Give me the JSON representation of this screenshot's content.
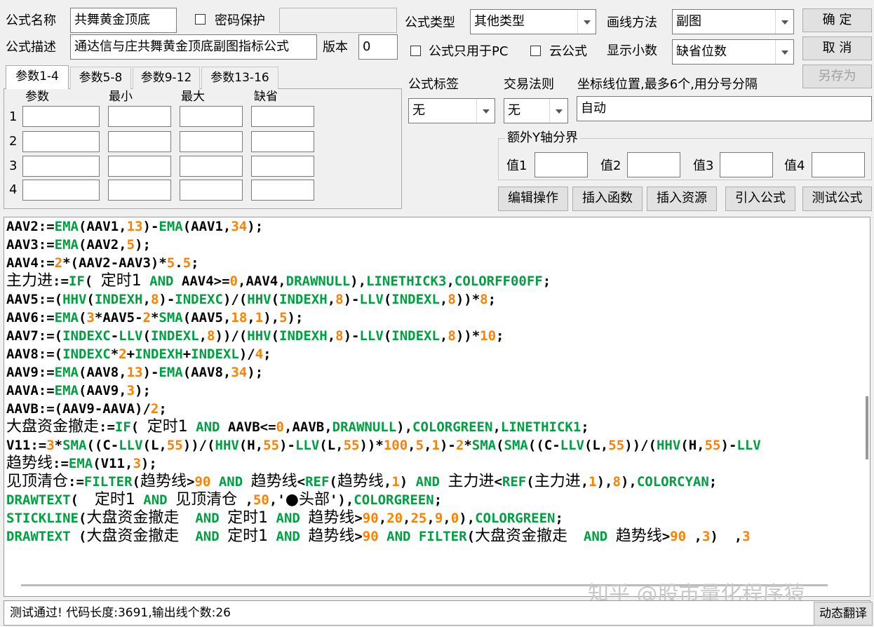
{
  "header": {
    "name_label": "公式名称",
    "name_value": "共舞黄金顶底",
    "password_label": "密码保护",
    "desc_label": "公式描述",
    "desc_value": "通达信与庄共舞黄金顶底副图指标公式",
    "version_label": "版本",
    "version_value": "0",
    "type_label": "公式类型",
    "type_value": "其他类型",
    "draw_label": "画线方法",
    "draw_value": "副图",
    "pc_only_label": "公式只用于PC",
    "cloud_label": "云公式",
    "decimals_label": "显示小数",
    "decimals_value": "缺省位数"
  },
  "buttons": {
    "ok": "确 定",
    "cancel": "取 消",
    "save_as": "另存为",
    "edit_op": "编辑操作",
    "insert_func": "插入函数",
    "insert_res": "插入资源",
    "import_formula": "引入公式",
    "test_formula": "测试公式",
    "dynamic_translate": "动态翻译"
  },
  "tabs": [
    "参数1-4",
    "参数5-8",
    "参数9-12",
    "参数13-16"
  ],
  "params": {
    "headers": [
      "参数",
      "最小",
      "最大",
      "缺省"
    ],
    "rows": [
      "1",
      "2",
      "3",
      "4"
    ]
  },
  "tags": {
    "tag_label": "公式标签",
    "tag_value": "无",
    "rule_label": "交易法则",
    "rule_value": "无",
    "axis_label": "坐标线位置,最多6个,用分号分隔",
    "axis_value": "自动"
  },
  "yaxis": {
    "title": "额外Y轴分界",
    "v1": "值1",
    "v2": "值2",
    "v3": "值3",
    "v4": "值4"
  },
  "code_lines": [
    [
      [
        "AAV2:=",
        ""
      ],
      [
        "EMA",
        "g"
      ],
      [
        "(AAV1,",
        ""
      ],
      [
        "13",
        "o"
      ],
      [
        ")-",
        ""
      ],
      [
        "EMA",
        "g"
      ],
      [
        "(AAV1,",
        ""
      ],
      [
        "34",
        "o"
      ],
      [
        ");",
        ""
      ]
    ],
    [
      [
        "AAV3:=",
        ""
      ],
      [
        "EMA",
        "g"
      ],
      [
        "(AAV2,",
        ""
      ],
      [
        "5",
        "o"
      ],
      [
        ");",
        ""
      ]
    ],
    [
      [
        "AAV4:=",
        ""
      ],
      [
        "2",
        "o"
      ],
      [
        "*(AAV2-AAV3)*",
        ""
      ],
      [
        "5",
        "o"
      ],
      [
        ".",
        ""
      ],
      [
        "5",
        "o"
      ],
      [
        ";",
        ""
      ]
    ],
    [
      [
        "主力进",
        "c"
      ],
      [
        ":=",
        ""
      ],
      [
        "IF",
        "g"
      ],
      [
        "( ",
        ""
      ],
      [
        "定时1",
        "c"
      ],
      [
        " ",
        ""
      ],
      [
        "AND",
        "g"
      ],
      [
        " AAV4>=",
        ""
      ],
      [
        "0",
        "o"
      ],
      [
        ",AAV4,",
        ""
      ],
      [
        "DRAWNULL",
        "g"
      ],
      [
        "),",
        ""
      ],
      [
        "LINETHICK3",
        "g"
      ],
      [
        ",",
        ""
      ],
      [
        "COLORFF00FF",
        "g"
      ],
      [
        ";",
        ""
      ]
    ],
    [
      [
        "AAV5:=(",
        ""
      ],
      [
        "HHV",
        "g"
      ],
      [
        "(",
        ""
      ],
      [
        "INDEXH",
        "g"
      ],
      [
        ",",
        ""
      ],
      [
        "8",
        "o"
      ],
      [
        ")-",
        ""
      ],
      [
        "INDEXC",
        "g"
      ],
      [
        ")/(",
        ""
      ],
      [
        "HHV",
        "g"
      ],
      [
        "(",
        ""
      ],
      [
        "INDEXH",
        "g"
      ],
      [
        ",",
        ""
      ],
      [
        "8",
        "o"
      ],
      [
        ")-",
        ""
      ],
      [
        "LLV",
        "g"
      ],
      [
        "(",
        ""
      ],
      [
        "INDEXL",
        "g"
      ],
      [
        ",",
        ""
      ],
      [
        "8",
        "o"
      ],
      [
        "))*",
        ""
      ],
      [
        "8",
        "o"
      ],
      [
        ";",
        ""
      ]
    ],
    [
      [
        "AAV6:=",
        ""
      ],
      [
        "EMA",
        "g"
      ],
      [
        "(",
        ""
      ],
      [
        "3",
        "o"
      ],
      [
        "*AAV5-",
        ""
      ],
      [
        "2",
        "o"
      ],
      [
        "*",
        ""
      ],
      [
        "SMA",
        "g"
      ],
      [
        "(AAV5,",
        ""
      ],
      [
        "18",
        "o"
      ],
      [
        ",",
        ""
      ],
      [
        "1",
        "o"
      ],
      [
        "),",
        ""
      ],
      [
        "5",
        "o"
      ],
      [
        ");",
        ""
      ]
    ],
    [
      [
        "AAV7:=(",
        ""
      ],
      [
        "INDEXC",
        "g"
      ],
      [
        "-",
        ""
      ],
      [
        "LLV",
        "g"
      ],
      [
        "(",
        ""
      ],
      [
        "INDEXL",
        "g"
      ],
      [
        ",",
        ""
      ],
      [
        "8",
        "o"
      ],
      [
        "))/(",
        ""
      ],
      [
        "HHV",
        "g"
      ],
      [
        "(",
        ""
      ],
      [
        "INDEXH",
        "g"
      ],
      [
        ",",
        ""
      ],
      [
        "8",
        "o"
      ],
      [
        ")-",
        ""
      ],
      [
        "LLV",
        "g"
      ],
      [
        "(",
        ""
      ],
      [
        "INDEXL",
        "g"
      ],
      [
        ",",
        ""
      ],
      [
        "8",
        "o"
      ],
      [
        "))*",
        ""
      ],
      [
        "10",
        "o"
      ],
      [
        ";",
        ""
      ]
    ],
    [
      [
        "AAV8:=(",
        ""
      ],
      [
        "INDEXC",
        "g"
      ],
      [
        "*",
        ""
      ],
      [
        "2",
        "o"
      ],
      [
        "+",
        ""
      ],
      [
        "INDEXH",
        "g"
      ],
      [
        "+",
        ""
      ],
      [
        "INDEXL",
        "g"
      ],
      [
        ")/",
        ""
      ],
      [
        "4",
        "o"
      ],
      [
        ";",
        ""
      ]
    ],
    [
      [
        "AAV9:=",
        ""
      ],
      [
        "EMA",
        "g"
      ],
      [
        "(AAV8,",
        ""
      ],
      [
        "13",
        "o"
      ],
      [
        ")-",
        ""
      ],
      [
        "EMA",
        "g"
      ],
      [
        "(AAV8,",
        ""
      ],
      [
        "34",
        "o"
      ],
      [
        ");",
        ""
      ]
    ],
    [
      [
        "AAVA:=",
        ""
      ],
      [
        "EMA",
        "g"
      ],
      [
        "(AAV9,",
        ""
      ],
      [
        "3",
        "o"
      ],
      [
        ");",
        ""
      ]
    ],
    [
      [
        "AAVB:=(AAV9-AAVA)/",
        ""
      ],
      [
        "2",
        "o"
      ],
      [
        ";",
        ""
      ]
    ],
    [
      [
        "大盘资金撤走",
        "c"
      ],
      [
        ":=",
        ""
      ],
      [
        "IF",
        "g"
      ],
      [
        "( ",
        ""
      ],
      [
        "定时1",
        "c"
      ],
      [
        " ",
        ""
      ],
      [
        "AND",
        "g"
      ],
      [
        " AAVB<=",
        ""
      ],
      [
        "0",
        "o"
      ],
      [
        ",AAVB,",
        ""
      ],
      [
        "DRAWNULL",
        "g"
      ],
      [
        "),",
        ""
      ],
      [
        "COLORGREEN",
        "g"
      ],
      [
        ",",
        ""
      ],
      [
        "LINETHICK1",
        "g"
      ],
      [
        ";",
        ""
      ]
    ],
    [
      [
        "V11:=",
        ""
      ],
      [
        "3",
        "o"
      ],
      [
        "*",
        ""
      ],
      [
        "SMA",
        "g"
      ],
      [
        "((C-",
        ""
      ],
      [
        "LLV",
        "g"
      ],
      [
        "(L,",
        ""
      ],
      [
        "55",
        "o"
      ],
      [
        "))/(",
        ""
      ],
      [
        "HHV",
        "g"
      ],
      [
        "(H,",
        ""
      ],
      [
        "55",
        "o"
      ],
      [
        ")-",
        ""
      ],
      [
        "LLV",
        "g"
      ],
      [
        "(L,",
        ""
      ],
      [
        "55",
        "o"
      ],
      [
        "))*",
        ""
      ],
      [
        "100",
        "o"
      ],
      [
        ",",
        ""
      ],
      [
        "5",
        "o"
      ],
      [
        ",",
        ""
      ],
      [
        "1",
        "o"
      ],
      [
        ")-",
        ""
      ],
      [
        "2",
        "o"
      ],
      [
        "*",
        ""
      ],
      [
        "SMA",
        "g"
      ],
      [
        "(",
        ""
      ],
      [
        "SMA",
        "g"
      ],
      [
        "((C-",
        ""
      ],
      [
        "LLV",
        "g"
      ],
      [
        "(L,",
        ""
      ],
      [
        "55",
        "o"
      ],
      [
        "))/(",
        ""
      ],
      [
        "HHV",
        "g"
      ],
      [
        "(H,",
        ""
      ],
      [
        "55",
        "o"
      ],
      [
        ")-",
        ""
      ],
      [
        "LLV",
        "g"
      ],
      [
        "",
        ""
      ]
    ],
    [
      [
        "趋势线",
        "c"
      ],
      [
        ":=",
        ""
      ],
      [
        "EMA",
        "g"
      ],
      [
        "(V11,",
        ""
      ],
      [
        "3",
        "o"
      ],
      [
        ");",
        ""
      ]
    ],
    [
      [
        "见顶清仓",
        "c"
      ],
      [
        ":=",
        ""
      ],
      [
        "FILTER",
        "g"
      ],
      [
        "(",
        ""
      ],
      [
        "趋势线",
        "c"
      ],
      [
        ">",
        ""
      ],
      [
        "90",
        "o"
      ],
      [
        " ",
        ""
      ],
      [
        "AND",
        "g"
      ],
      [
        " ",
        ""
      ],
      [
        "趋势线",
        "c"
      ],
      [
        "<",
        ""
      ],
      [
        "REF",
        "g"
      ],
      [
        "(",
        ""
      ],
      [
        "趋势线",
        "c"
      ],
      [
        ",",
        ""
      ],
      [
        "1",
        "o"
      ],
      [
        ") ",
        ""
      ],
      [
        "AND",
        "g"
      ],
      [
        " ",
        ""
      ],
      [
        "主力进",
        "c"
      ],
      [
        "<",
        ""
      ],
      [
        "REF",
        "g"
      ],
      [
        "(",
        ""
      ],
      [
        "主力进",
        "c"
      ],
      [
        ",",
        ""
      ],
      [
        "1",
        "o"
      ],
      [
        "),",
        ""
      ],
      [
        "8",
        "o"
      ],
      [
        "),",
        ""
      ],
      [
        "COLORCYAN",
        "g"
      ],
      [
        ";",
        ""
      ]
    ],
    [
      [
        "DRAWTEXT",
        "g"
      ],
      [
        "(  ",
        ""
      ],
      [
        "定时1",
        "c"
      ],
      [
        " ",
        ""
      ],
      [
        "AND",
        "g"
      ],
      [
        " ",
        ""
      ],
      [
        "见顶清仓",
        "c"
      ],
      [
        " ,",
        ""
      ],
      [
        "50",
        "o"
      ],
      [
        ",'",
        ""
      ],
      [
        "●头部",
        "c"
      ],
      [
        "'),",
        ""
      ],
      [
        "COLORGREEN",
        "g"
      ],
      [
        ";",
        ""
      ]
    ],
    [
      [
        "STICKLINE",
        "g"
      ],
      [
        "(",
        ""
      ],
      [
        "大盘资金撤走",
        "c"
      ],
      [
        "  ",
        ""
      ],
      [
        "AND",
        "g"
      ],
      [
        " ",
        ""
      ],
      [
        "定时1",
        "c"
      ],
      [
        " ",
        ""
      ],
      [
        "AND",
        "g"
      ],
      [
        " ",
        ""
      ],
      [
        "趋势线",
        "c"
      ],
      [
        ">",
        ""
      ],
      [
        "90",
        "o"
      ],
      [
        ",",
        ""
      ],
      [
        "20",
        "o"
      ],
      [
        ",",
        ""
      ],
      [
        "25",
        "o"
      ],
      [
        ",",
        ""
      ],
      [
        "9",
        "o"
      ],
      [
        ",",
        ""
      ],
      [
        "0",
        "o"
      ],
      [
        "),",
        ""
      ],
      [
        "COLORGREEN",
        "g"
      ],
      [
        ";",
        ""
      ]
    ],
    [
      [
        "DRAWTEXT",
        "g"
      ],
      [
        " (",
        ""
      ],
      [
        "大盘资金撤走",
        "c"
      ],
      [
        "  ",
        ""
      ],
      [
        "AND",
        "g"
      ],
      [
        " ",
        ""
      ],
      [
        "定时1",
        "c"
      ],
      [
        " ",
        ""
      ],
      [
        "AND",
        "g"
      ],
      [
        " ",
        ""
      ],
      [
        "趋势线",
        "c"
      ],
      [
        ">",
        ""
      ],
      [
        "90",
        "o"
      ],
      [
        " ",
        ""
      ],
      [
        "AND",
        "g"
      ],
      [
        " ",
        ""
      ],
      [
        "FILTER",
        "g"
      ],
      [
        "(",
        ""
      ],
      [
        "大盘资金撤走",
        "c"
      ],
      [
        "  ",
        ""
      ],
      [
        "AND",
        "g"
      ],
      [
        " ",
        ""
      ],
      [
        "趋势线",
        "c"
      ],
      [
        ">",
        ""
      ],
      [
        "90",
        "o"
      ],
      [
        " ,",
        ""
      ],
      [
        "3",
        "o"
      ],
      [
        ")  ,",
        ""
      ],
      [
        "3",
        "o"
      ]
    ]
  ],
  "status": {
    "text": "测试通过! 代码长度:3691,输出线个数:26"
  },
  "watermark": "知乎 @股市量化程序猿"
}
